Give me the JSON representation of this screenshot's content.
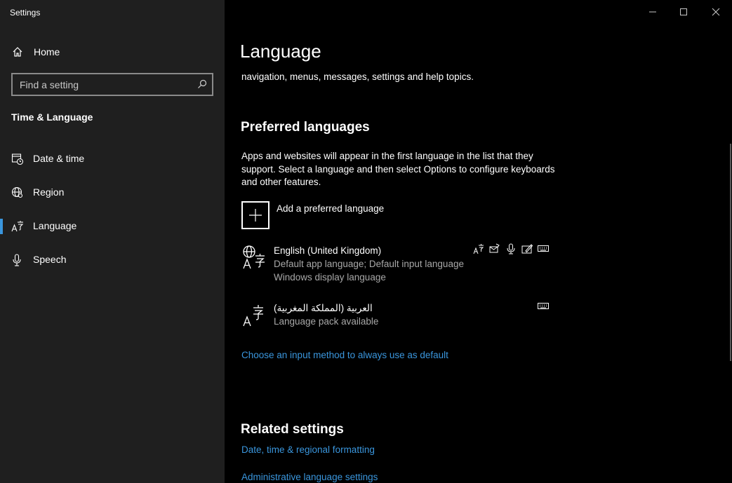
{
  "window": {
    "title": "Settings",
    "colors": {
      "sidebar_bg": "#1f1f1f",
      "content_bg": "#000000",
      "accent": "#3a96dd",
      "muted_text": "#a8a8a8"
    }
  },
  "sidebar": {
    "home_label": "Home",
    "home_icon": "home-icon",
    "search_placeholder": "Find a setting",
    "section_title": "Time & Language",
    "items": [
      {
        "label": "Date & time",
        "icon": "date-time-icon",
        "selected": false
      },
      {
        "label": "Region",
        "icon": "region-globe-icon",
        "selected": false
      },
      {
        "label": "Language",
        "icon": "language-icon",
        "selected": true
      },
      {
        "label": "Speech",
        "icon": "microphone-icon",
        "selected": false
      }
    ]
  },
  "main": {
    "title": "Language",
    "intro_text": "navigation, menus, messages, settings and help topics.",
    "preferred": {
      "heading": "Preferred languages",
      "description": "Apps and websites will appear in the first language in the list that they support. Select a language and then select Options to configure keyboards and other features.",
      "add_label": "Add a preferred language",
      "languages": [
        {
          "name": "English (United Kingdom)",
          "subtitle1": "Default app language; Default input language",
          "subtitle2": "Windows display language",
          "features": [
            "language-pack-icon",
            "text-to-speech-icon",
            "speech-recognition-icon",
            "handwriting-icon",
            "keyboard-icon"
          ]
        },
        {
          "name": "العربية (المملكة المغربية)",
          "subtitle1": "Language pack available",
          "features": [
            "keyboard-icon"
          ]
        }
      ],
      "input_method_link": "Choose an input method to always use as default"
    },
    "related": {
      "heading": "Related settings",
      "links": [
        "Date, time & regional formatting",
        "Administrative language settings"
      ]
    }
  }
}
